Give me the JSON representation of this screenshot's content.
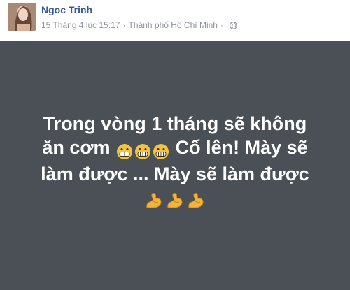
{
  "post": {
    "author": "Ngoc Trinh",
    "timestamp": "15 Tháng 4 lúc 15:17",
    "separator1": "·",
    "location": "Thành phố Hồ Chí Minh",
    "separator2": "·",
    "privacy_icon": "globe-icon",
    "text_line1": "Trong vòng 1 tháng sẽ không",
    "text_line2_a": "ăn cơm",
    "text_line2_b": "Cố lên! Mày sẽ",
    "text_line3": "làm được ... Mày sẽ làm được",
    "emoji_grimace": "grimacing-face-icon",
    "emoji_muscle": "flexed-biceps-icon",
    "background_color": "#4b4f56",
    "text_color": "#ffffff",
    "name_color": "#365899"
  }
}
